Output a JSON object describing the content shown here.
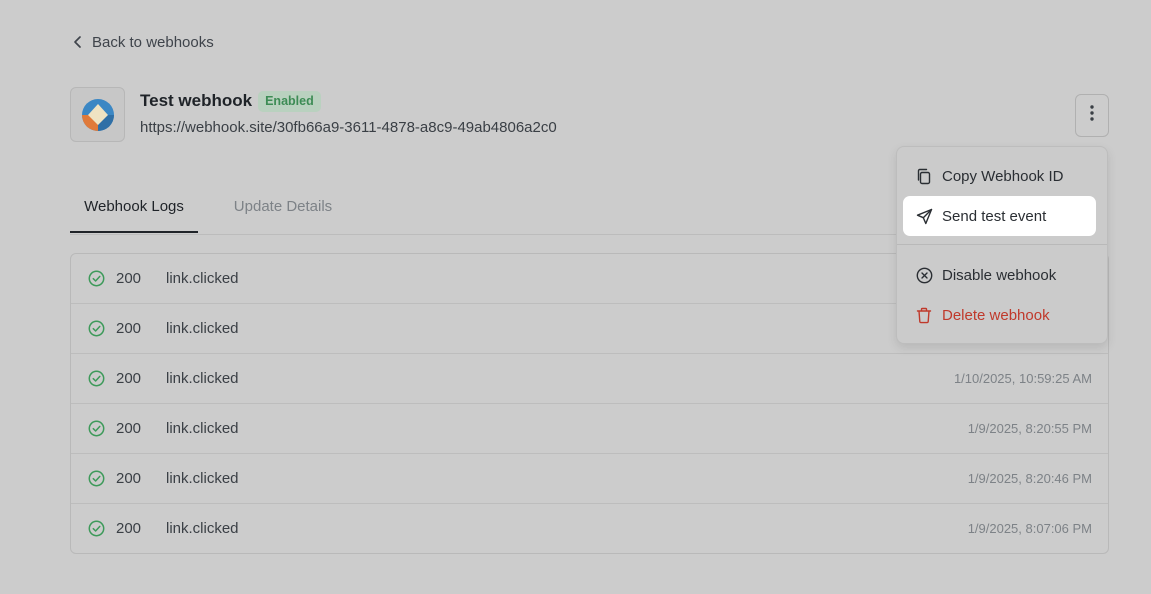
{
  "nav": {
    "back_label": "Back to webhooks"
  },
  "webhook": {
    "name": "Test webhook",
    "status": "Enabled",
    "url": "https://webhook.site/30fb66a9-3611-4878-a8c9-49ab4806a2c0"
  },
  "tabs": [
    {
      "label": "Webhook Logs",
      "active": true
    },
    {
      "label": "Update Details",
      "active": false
    }
  ],
  "logs": [
    {
      "status_code": "200",
      "event": "link.clicked",
      "timestamp": ""
    },
    {
      "status_code": "200",
      "event": "link.clicked",
      "timestamp": ""
    },
    {
      "status_code": "200",
      "event": "link.clicked",
      "timestamp": "1/10/2025, 10:59:25 AM"
    },
    {
      "status_code": "200",
      "event": "link.clicked",
      "timestamp": "1/9/2025, 8:20:55 PM"
    },
    {
      "status_code": "200",
      "event": "link.clicked",
      "timestamp": "1/9/2025, 8:20:46 PM"
    },
    {
      "status_code": "200",
      "event": "link.clicked",
      "timestamp": "1/9/2025, 8:07:06 PM"
    }
  ],
  "menu": {
    "items": [
      {
        "label": "Copy Webhook ID",
        "icon": "copy-icon"
      },
      {
        "label": "Send test event",
        "icon": "send-icon",
        "highlighted": true
      },
      {
        "label": "Disable webhook",
        "icon": "circle-x-icon"
      },
      {
        "label": "Delete webhook",
        "icon": "trash-icon",
        "danger": true
      }
    ]
  },
  "colors": {
    "background": "#cccccc",
    "success": "#3d9a5a",
    "enabled_badge_text": "#3d8c55",
    "danger": "#c0392b",
    "menu_highlight": "#ffffff"
  }
}
